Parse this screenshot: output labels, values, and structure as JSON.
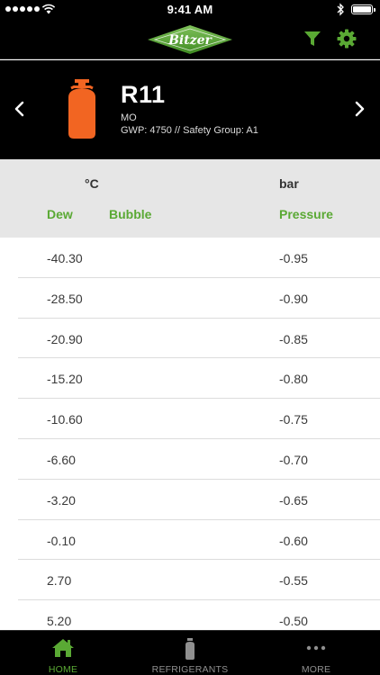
{
  "status_bar": {
    "time": "9:41 AM"
  },
  "nav": {
    "logo_text": "Bitzer"
  },
  "refrigerant": {
    "name": "R11",
    "type": "MO",
    "info": "GWP: 4750 // Safety Group: A1",
    "bottle_color": "#f26522"
  },
  "table": {
    "temp_unit": "°C",
    "pressure_unit": "bar",
    "col_dew": "Dew",
    "col_bubble": "Bubble",
    "col_pressure": "Pressure",
    "rows": [
      {
        "temp": "-40.30",
        "pressure": "-0.95"
      },
      {
        "temp": "-28.50",
        "pressure": "-0.90"
      },
      {
        "temp": "-20.90",
        "pressure": "-0.85"
      },
      {
        "temp": "-15.20",
        "pressure": "-0.80"
      },
      {
        "temp": "-10.60",
        "pressure": "-0.75"
      },
      {
        "temp": "-6.60",
        "pressure": "-0.70"
      },
      {
        "temp": "-3.20",
        "pressure": "-0.65"
      },
      {
        "temp": "-0.10",
        "pressure": "-0.60"
      },
      {
        "temp": "2.70",
        "pressure": "-0.55"
      },
      {
        "temp": "5.20",
        "pressure": "-0.50"
      }
    ]
  },
  "tabs": [
    {
      "label": "HOME",
      "icon": "home-icon",
      "active": true
    },
    {
      "label": "REFRIGERANTS",
      "icon": "bottle-icon",
      "active": false
    },
    {
      "label": "MORE",
      "icon": "more-icon",
      "active": false
    }
  ],
  "colors": {
    "accent": "#5aa934",
    "header_bg": "#000000",
    "table_head_bg": "#e6e6e6"
  }
}
